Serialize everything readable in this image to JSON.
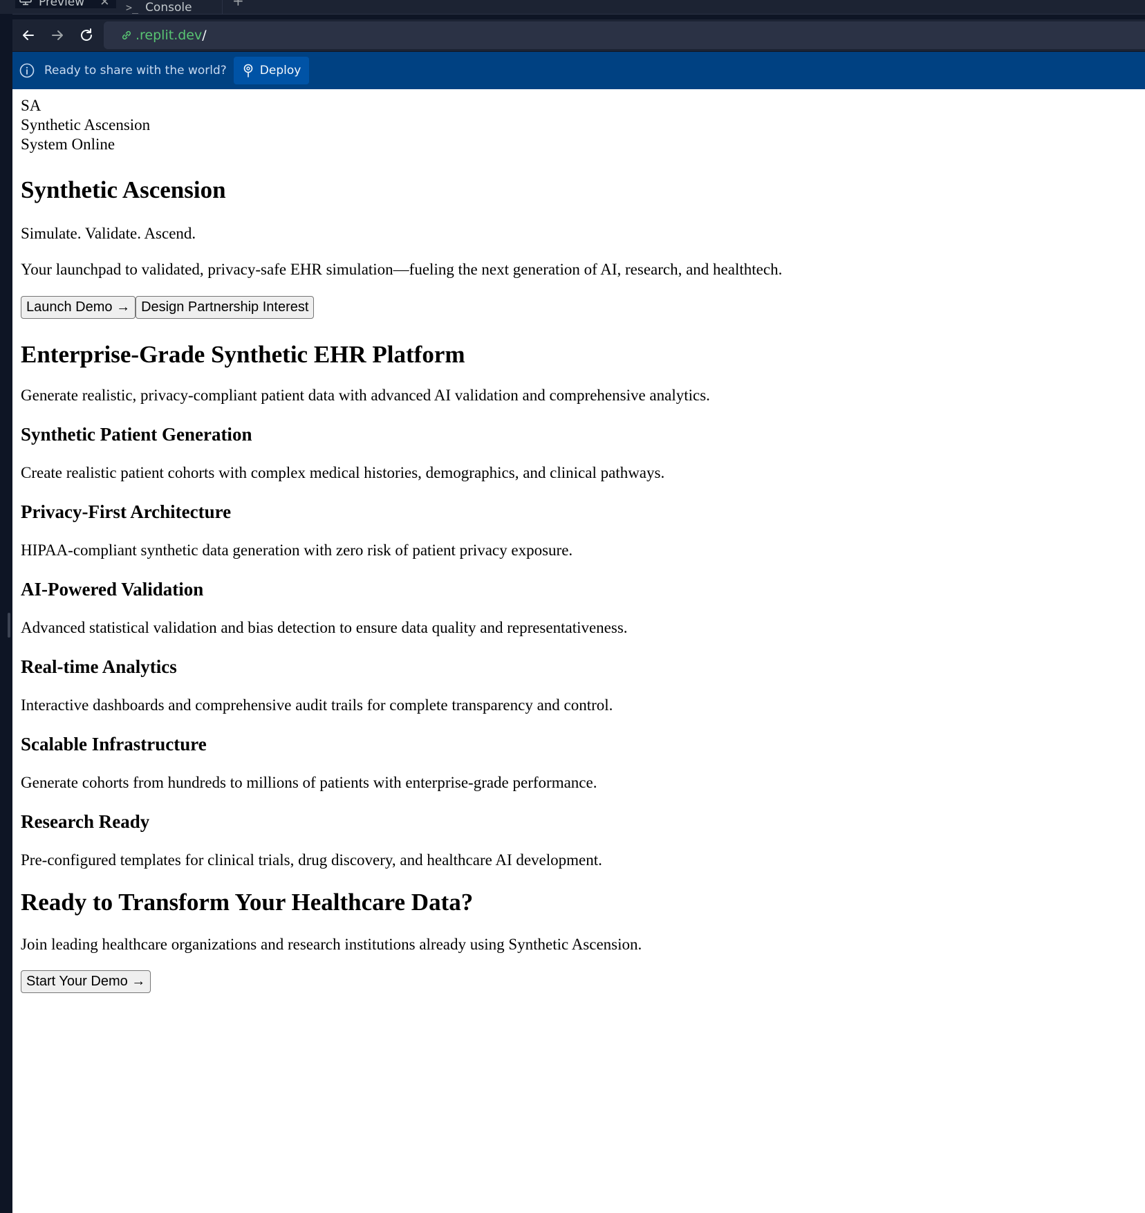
{
  "tabs": [
    {
      "label": "Preview",
      "icon": "monitor-icon"
    },
    {
      "label": "Console",
      "icon": "terminal-icon"
    }
  ],
  "address_bar": {
    "host": ".replit.dev",
    "path": "/"
  },
  "banner": {
    "message": "Ready to share with the world?",
    "deploy_label": "Deploy"
  },
  "page": {
    "brand": {
      "initials": "SA",
      "name": "Synthetic Ascension",
      "status": "System Online"
    },
    "hero": {
      "title": "Synthetic Ascension",
      "tagline": "Simulate. Validate. Ascend.",
      "lead": "Your launchpad to validated, privacy-safe EHR simulation—fueling the next generation of AI, research, and healthtech.",
      "primary_button": "Launch Demo →",
      "secondary_button": "Design Partnership Interest"
    },
    "platform": {
      "title": "Enterprise-Grade Synthetic EHR Platform",
      "subtitle": "Generate realistic, privacy-compliant patient data with advanced AI validation and comprehensive analytics."
    },
    "features": [
      {
        "title": "Synthetic Patient Generation",
        "desc": "Create realistic patient cohorts with complex medical histories, demographics, and clinical pathways."
      },
      {
        "title": "Privacy-First Architecture",
        "desc": "HIPAA-compliant synthetic data generation with zero risk of patient privacy exposure."
      },
      {
        "title": "AI-Powered Validation",
        "desc": "Advanced statistical validation and bias detection to ensure data quality and representativeness."
      },
      {
        "title": "Real-time Analytics",
        "desc": "Interactive dashboards and comprehensive audit trails for complete transparency and control."
      },
      {
        "title": "Scalable Infrastructure",
        "desc": "Generate cohorts from hundreds to millions of patients with enterprise-grade performance."
      },
      {
        "title": "Research Ready",
        "desc": "Pre-configured templates for clinical trials, drug discovery, and healthcare AI development."
      }
    ],
    "cta": {
      "title": "Ready to Transform Your Healthcare Data?",
      "text": "Join leading healthcare organizations and research institutions already using Synthetic Ascension.",
      "button": "Start Your Demo →"
    }
  },
  "colors": {
    "chrome_bg": "#1c2333",
    "url_host": "#58c472",
    "banner_bg": "#004182",
    "deploy_btn_bg": "#0053a6"
  }
}
